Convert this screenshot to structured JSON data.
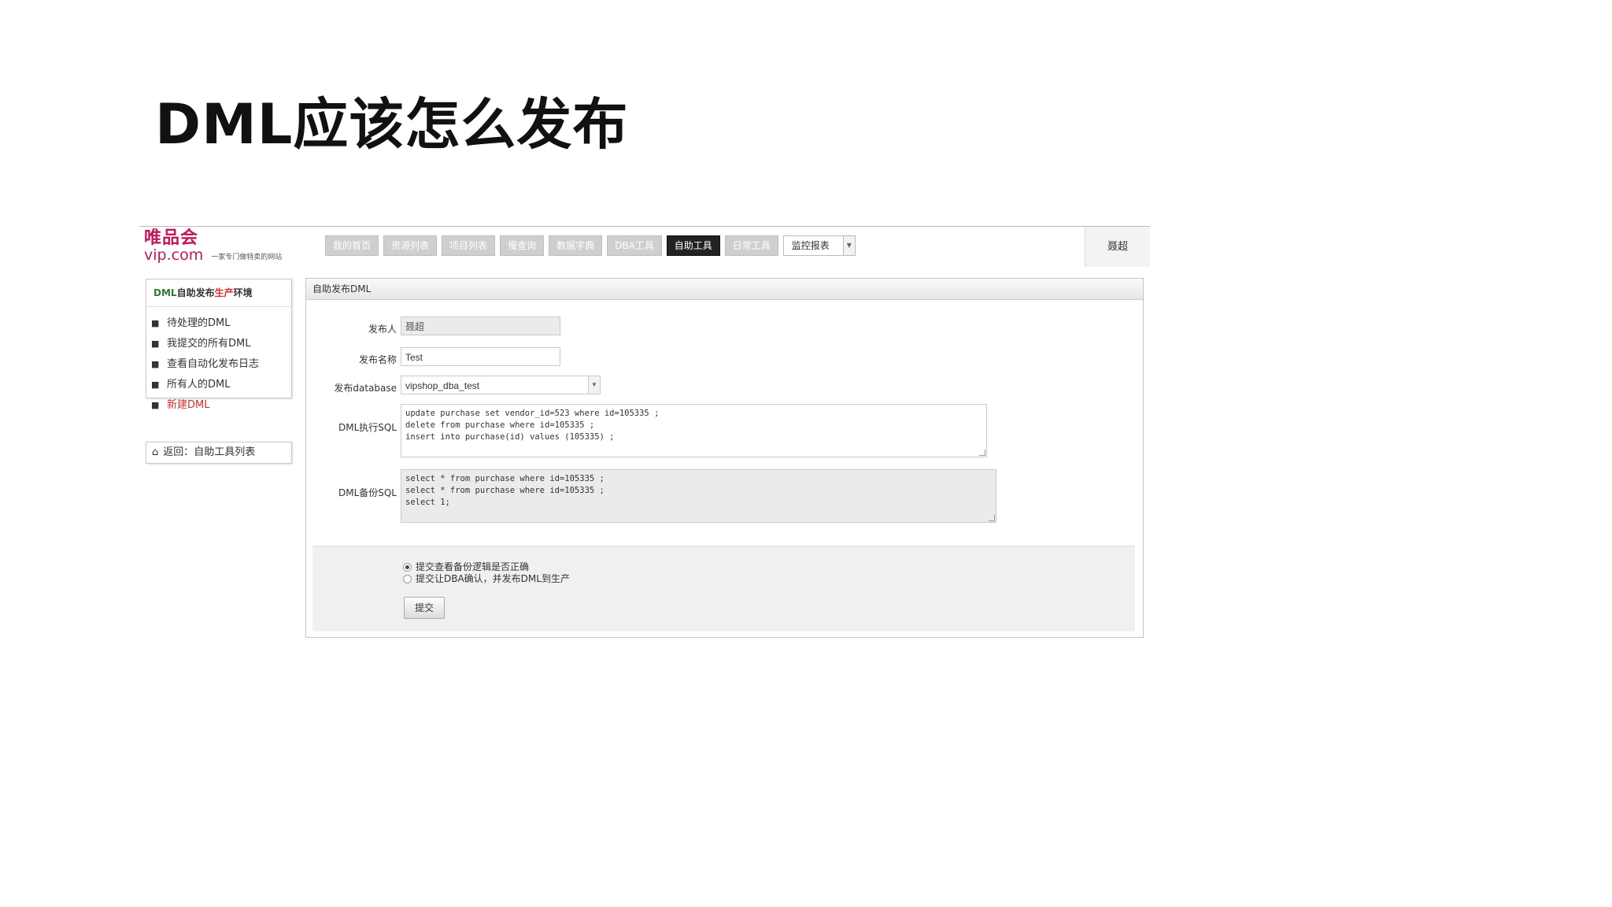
{
  "slide": {
    "title": "DML应该怎么发布"
  },
  "header": {
    "logo_cn": "唯品会",
    "logo_en": "vip.com",
    "logo_slogan": "一家专门做特卖的网站",
    "nav_tabs": [
      "我的首页",
      "资源列表",
      "项目列表",
      "慢查询",
      "数据字典",
      "DBA工具",
      "自助工具",
      "日常工具"
    ],
    "active_tab": "自助工具",
    "nav_select": "监控报表",
    "user_name": "聂超"
  },
  "sidebar": {
    "title_prefix": "DML",
    "title_middle": "自助发布",
    "title_highlight": "生产",
    "title_suffix": "环境",
    "items": [
      {
        "label": "待处理的DML"
      },
      {
        "label": "我提交的所有DML"
      },
      {
        "label": "查看自动化发布日志"
      },
      {
        "label": "所有人的DML"
      },
      {
        "label": "新建DML"
      }
    ],
    "back_label": "返回：自助工具列表"
  },
  "form": {
    "panel_title": "自助发布DML",
    "publisher_label": "发布人",
    "publisher_value": "聂超",
    "name_label": "发布名称",
    "name_value": "Test",
    "database_label": "发布database",
    "database_value": "vipshop_dba_test",
    "exec_sql_label": "DML执行SQL",
    "exec_sql_value": "update purchase set vendor_id=523 where id=105335 ;\ndelete from purchase where id=105335 ;\ninsert into purchase(id) values (105335) ;",
    "backup_sql_label": "DML备份SQL",
    "backup_sql_value": "select * from purchase where id=105335 ;\nselect * from purchase where id=105335 ;\nselect 1;",
    "radio_options": [
      "提交查看备份逻辑是否正确",
      "提交让DBA确认，并发布DML到生产"
    ],
    "radio_selected": 0,
    "submit_label": "提交"
  }
}
